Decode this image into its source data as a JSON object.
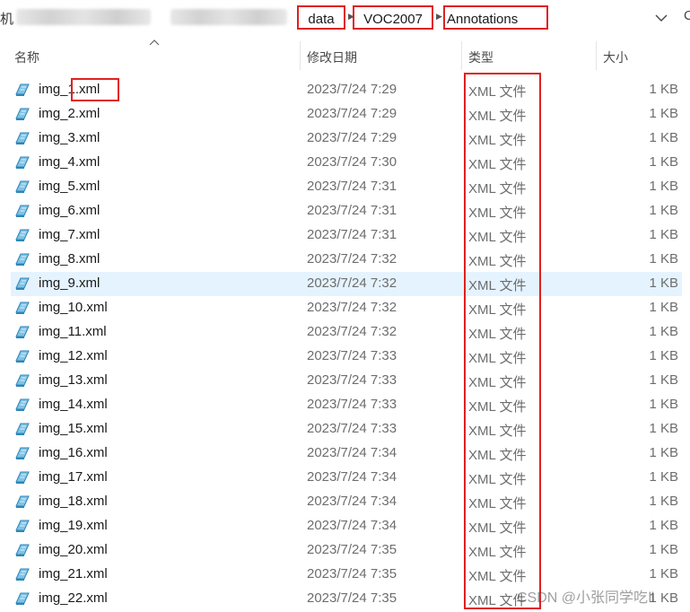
{
  "breadcrumb": {
    "left_fragment": "机",
    "items": [
      {
        "label": "data"
      },
      {
        "label": "VOC2007"
      },
      {
        "label": "Annotations"
      }
    ],
    "right_fragment": "C"
  },
  "columns": {
    "name": "名称",
    "modified": "修改日期",
    "type": "类型",
    "size": "大小"
  },
  "files": [
    {
      "name": "img_1.xml",
      "modified": "2023/7/24 7:29",
      "type": "XML 文件",
      "size": "1 KB"
    },
    {
      "name": "img_2.xml",
      "modified": "2023/7/24 7:29",
      "type": "XML 文件",
      "size": "1 KB"
    },
    {
      "name": "img_3.xml",
      "modified": "2023/7/24 7:29",
      "type": "XML 文件",
      "size": "1 KB"
    },
    {
      "name": "img_4.xml",
      "modified": "2023/7/24 7:30",
      "type": "XML 文件",
      "size": "1 KB"
    },
    {
      "name": "img_5.xml",
      "modified": "2023/7/24 7:31",
      "type": "XML 文件",
      "size": "1 KB"
    },
    {
      "name": "img_6.xml",
      "modified": "2023/7/24 7:31",
      "type": "XML 文件",
      "size": "1 KB"
    },
    {
      "name": "img_7.xml",
      "modified": "2023/7/24 7:31",
      "type": "XML 文件",
      "size": "1 KB"
    },
    {
      "name": "img_8.xml",
      "modified": "2023/7/24 7:32",
      "type": "XML 文件",
      "size": "1 KB"
    },
    {
      "name": "img_9.xml",
      "modified": "2023/7/24 7:32",
      "type": "XML 文件",
      "size": "1 KB"
    },
    {
      "name": "img_10.xml",
      "modified": "2023/7/24 7:32",
      "type": "XML 文件",
      "size": "1 KB"
    },
    {
      "name": "img_11.xml",
      "modified": "2023/7/24 7:32",
      "type": "XML 文件",
      "size": "1 KB"
    },
    {
      "name": "img_12.xml",
      "modified": "2023/7/24 7:33",
      "type": "XML 文件",
      "size": "1 KB"
    },
    {
      "name": "img_13.xml",
      "modified": "2023/7/24 7:33",
      "type": "XML 文件",
      "size": "1 KB"
    },
    {
      "name": "img_14.xml",
      "modified": "2023/7/24 7:33",
      "type": "XML 文件",
      "size": "1 KB"
    },
    {
      "name": "img_15.xml",
      "modified": "2023/7/24 7:33",
      "type": "XML 文件",
      "size": "1 KB"
    },
    {
      "name": "img_16.xml",
      "modified": "2023/7/24 7:34",
      "type": "XML 文件",
      "size": "1 KB"
    },
    {
      "name": "img_17.xml",
      "modified": "2023/7/24 7:34",
      "type": "XML 文件",
      "size": "1 KB"
    },
    {
      "name": "img_18.xml",
      "modified": "2023/7/24 7:34",
      "type": "XML 文件",
      "size": "1 KB"
    },
    {
      "name": "img_19.xml",
      "modified": "2023/7/24 7:34",
      "type": "XML 文件",
      "size": "1 KB"
    },
    {
      "name": "img_20.xml",
      "modified": "2023/7/24 7:35",
      "type": "XML 文件",
      "size": "1 KB"
    },
    {
      "name": "img_21.xml",
      "modified": "2023/7/24 7:35",
      "type": "XML 文件",
      "size": "1 KB"
    },
    {
      "name": "img_22.xml",
      "modified": "2023/7/24 7:35",
      "type": "XML 文件",
      "size": "1 KB"
    }
  ],
  "selected_file": "img_9.xml",
  "watermark": "CSDN @小张同学吃Ⅱ",
  "colors": {
    "annotation_red": "#e02020",
    "selection": "#e5f3ff",
    "secondary_text": "#6d6d6d"
  },
  "icons": {
    "file": "xml-file-icon",
    "dropdown": "chevron-down-icon",
    "sort": "sort-ascending-caret-icon",
    "separator": "chevron-right-icon"
  }
}
